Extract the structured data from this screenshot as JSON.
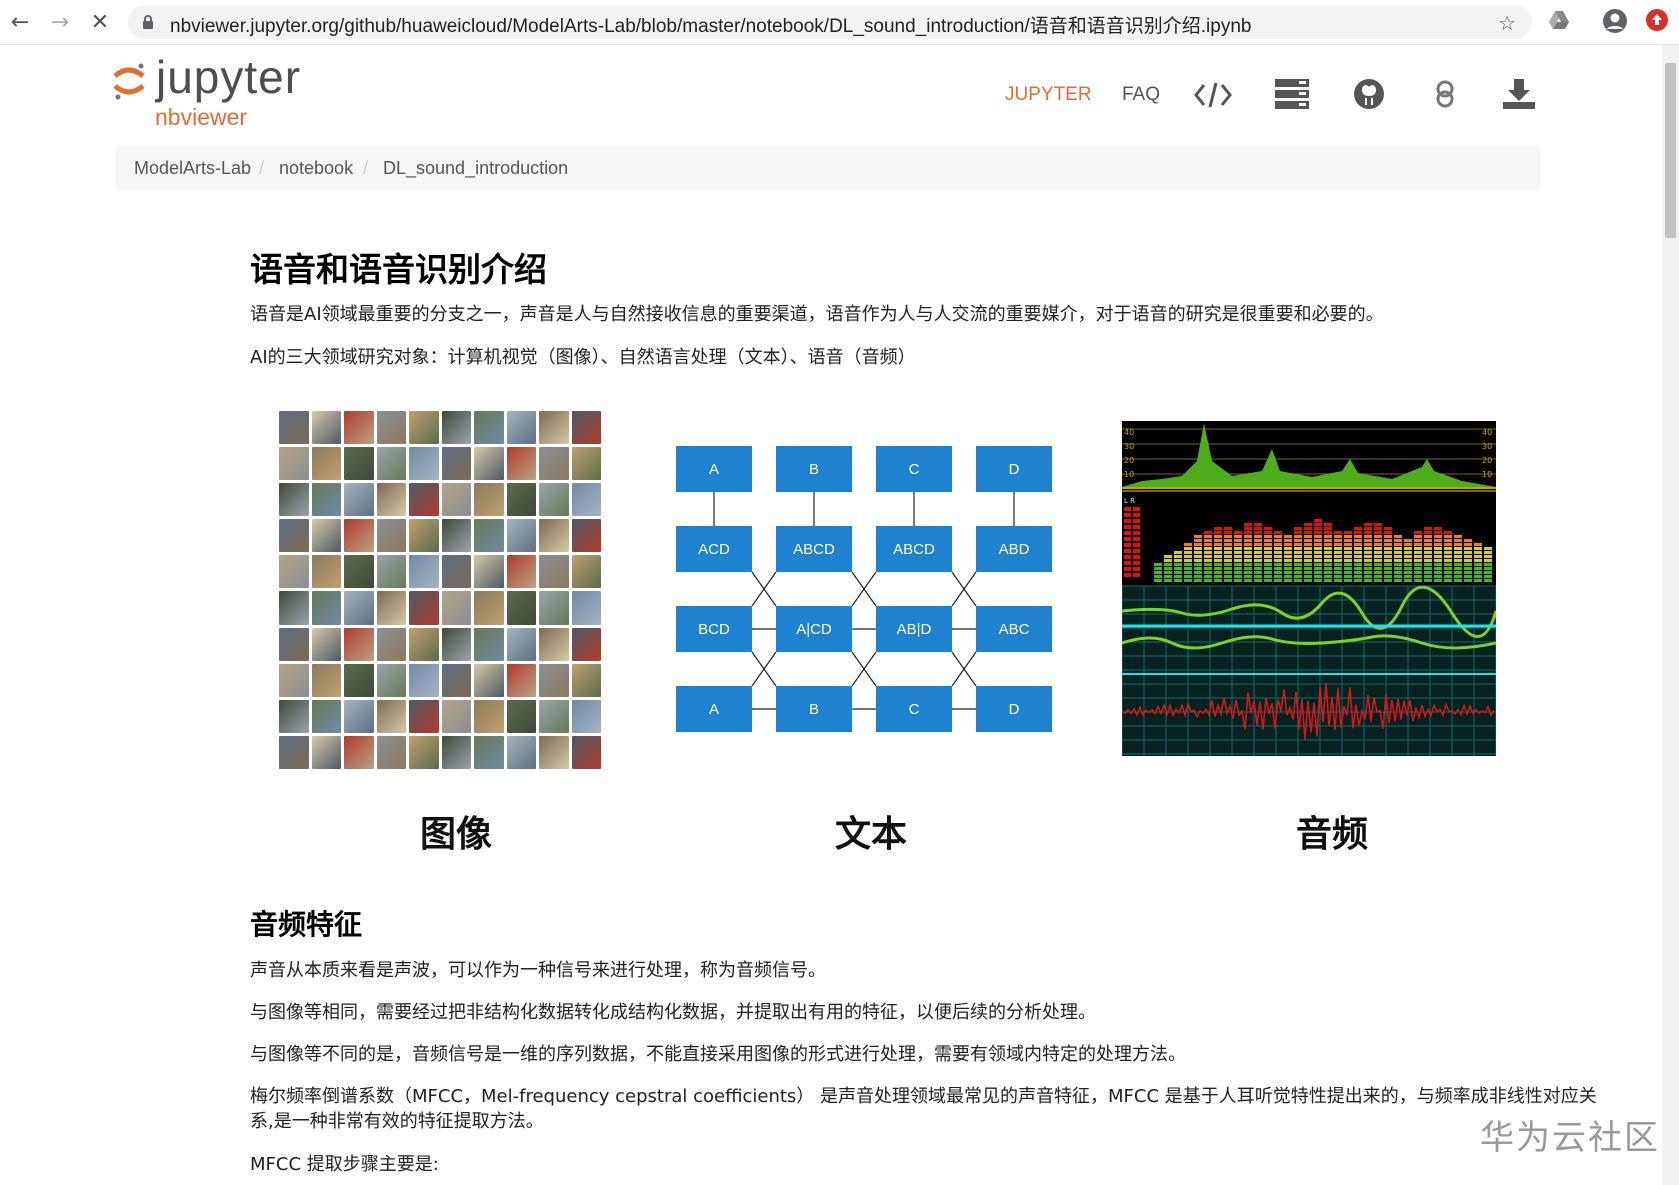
{
  "browser": {
    "url": "nbviewer.jupyter.org/github/huaweicloud/ModelArts-Lab/blob/master/notebook/DL_sound_introduction/语音和语音识别介绍.ipynb"
  },
  "header": {
    "logo_text": "jupyter",
    "logo_sub": "nbviewer",
    "nav": {
      "jupyter": "JUPYTER",
      "faq": "FAQ"
    },
    "accent_color": "#e46e2e"
  },
  "breadcrumb": [
    "ModelArts-Lab",
    "notebook",
    "DL_sound_introduction"
  ],
  "content": {
    "title": "语音和语音识别介绍",
    "intro": "语音是AI领域最重要的分支之一，声音是人与自然接收信息的重要渠道，语音作为人与人交流的重要媒介，对于语音的研究是很重要和必要的。",
    "fields": "AI的三大领域研究对象：计算机视觉（图像）、自然语言处理（文本）、语音（音频）",
    "captions": [
      "图像",
      "文本",
      "音频"
    ],
    "diagram": {
      "row1": [
        "A",
        "B",
        "C",
        "D"
      ],
      "row2": [
        "ACD",
        "ABCD",
        "ABCD",
        "ABD"
      ],
      "row3": [
        "BCD",
        "A|CD",
        "AB|D",
        "ABC"
      ],
      "row4": [
        "A",
        "B",
        "C",
        "D"
      ]
    },
    "audio_scale": [
      "40",
      "30",
      "20",
      "10"
    ],
    "audio_lr": "L  R",
    "section_title": "音频特征",
    "para1": "声音从本质来看是声波，可以作为一种信号来进行处理，称为音频信号。",
    "para2": "与图像等相同，需要经过把非结构化数据转化成结构化数据，并提取出有用的特征，以便后续的分析处理。",
    "para3": "与图像等不同的是，音频信号是一维的序列数据，不能直接采用图像的形式进行处理，需要有领域内特定的处理方法。",
    "para4_line1": "梅尔频率倒谱系数（MFCC，Mel-frequency cepstral coefficients） 是声音处理领域最常见的声音特征，MFCC 是基于人耳听觉特性提出来的，与频率成非线性对应关",
    "para4_line2": "系,是一种非常有效的特征提取方法。",
    "para5": "MFCC 提取步骤主要是:"
  },
  "watermark": "华为云社区"
}
